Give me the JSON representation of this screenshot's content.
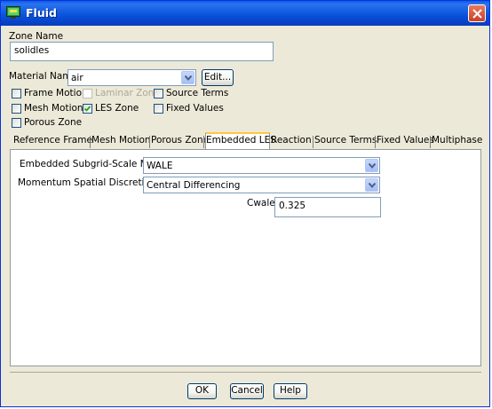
{
  "window": {
    "title": "Fluid"
  },
  "zone": {
    "label": "Zone Name",
    "value": "solidles"
  },
  "material": {
    "label": "Material Name",
    "value": "air",
    "edit_label": "Edit..."
  },
  "options": {
    "frame_motion": {
      "label": "Frame Motion",
      "checked": false
    },
    "laminar_zone": {
      "label": "Laminar Zone",
      "checked": false,
      "disabled": true
    },
    "source_terms": {
      "label": "Source Terms",
      "checked": false
    },
    "mesh_motion": {
      "label": "Mesh Motion",
      "checked": false
    },
    "les_zone": {
      "label": "LES Zone",
      "checked": true
    },
    "fixed_values": {
      "label": "Fixed Values",
      "checked": false
    },
    "porous_zone": {
      "label": "Porous Zone",
      "checked": false
    }
  },
  "tabs": [
    {
      "label": "Reference Frame",
      "active": false
    },
    {
      "label": "Mesh Motion",
      "active": false
    },
    {
      "label": "Porous Zone",
      "active": false
    },
    {
      "label": "Embedded LES",
      "active": true
    },
    {
      "label": "Reaction",
      "active": false
    },
    {
      "label": "Source Terms",
      "active": false
    },
    {
      "label": "Fixed Values",
      "active": false
    },
    {
      "label": "Multiphase",
      "active": false
    }
  ],
  "les": {
    "sgs_label": "Embedded Subgrid-Scale Model",
    "sgs_value": "WALE",
    "momentum_label": "Momentum Spatial Discretization",
    "momentum_value": "Central Differencing",
    "cwale_label": "Cwale",
    "cwale_value": "0.325"
  },
  "buttons": {
    "ok": "OK",
    "cancel": "Cancel",
    "help": "Help"
  },
  "colors": {
    "titlebar": "#0a55dc",
    "dialog_bg": "#ece9d8",
    "active_tab_accent": "#ffc83c"
  }
}
